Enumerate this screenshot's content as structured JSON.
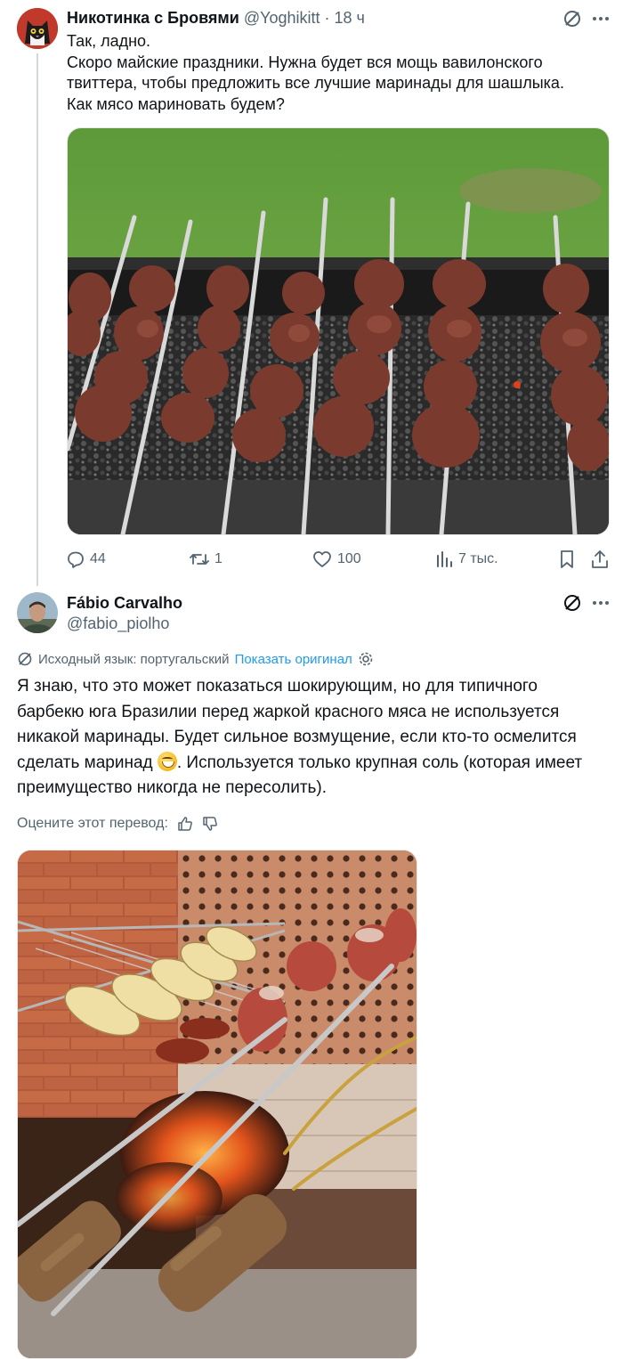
{
  "tweet": {
    "author_name": "Никотинка с Бровями",
    "author_handle": "@Yoghikitt",
    "separator": "·",
    "time": "18 ч",
    "text": "Так, ладно.\nСкоро майские праздники. Нужна будет вся мощь вавилонского твиттера, чтобы предложить все лучшие маринады для шашлыка.\nКак мясо мариновать будем?",
    "replies": "44",
    "retweets": "1",
    "likes": "100",
    "views": "7 тыс."
  },
  "reply": {
    "author_name": "Fábio Carvalho",
    "author_handle": "@fabio_piolho",
    "translation_source": "Исходный язык: португальский",
    "show_original": "Показать оригинал",
    "text_part1": "Я знаю, что это может показаться шокирующим, но для типичного барбекю юга Бразилии перед жаркой красного мяса не используется никакой маринады. Будет сильное возмущение, если кто-то осмелится сделать маринад",
    "text_part2": ". Используется только крупная соль (которая имеет преимущество никогда не пересолить).",
    "rate_translation": "Оцените этот перевод:"
  },
  "icons": {
    "more": "more-icon",
    "grok": "grok-icon",
    "reply": "reply-icon",
    "retweet": "retweet-icon",
    "like": "like-icon",
    "views": "views-icon",
    "bookmark": "bookmark-icon",
    "share": "share-icon",
    "translate": "translate-icon",
    "settings": "settings-icon",
    "thumbs_up": "thumbs-up-icon",
    "thumbs_down": "thumbs-down-icon"
  },
  "colors": {
    "link": "#1d9bf0",
    "muted": "#536471",
    "text": "#0f1419"
  }
}
